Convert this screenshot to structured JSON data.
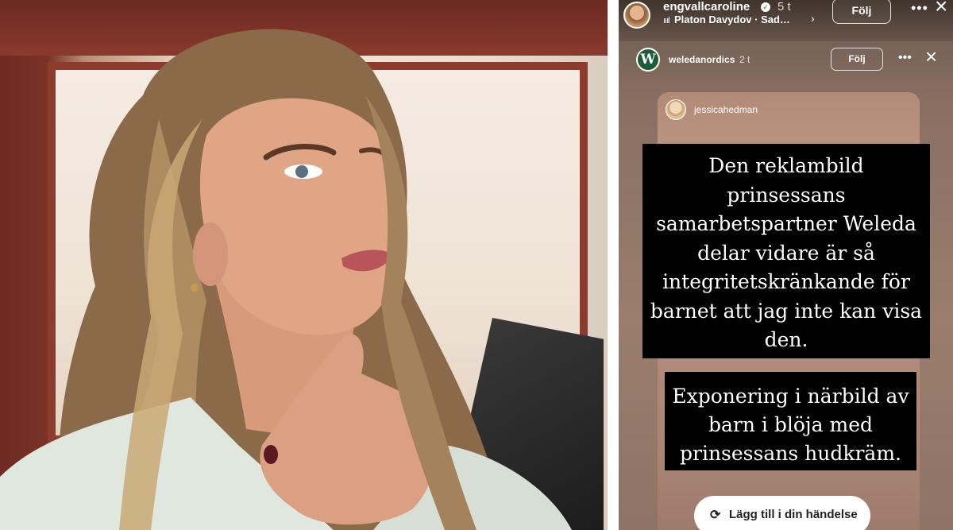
{
  "story": {
    "username": "engvallcaroline",
    "time": "5 t",
    "music": "Platon Davydov · Sad…",
    "follow_label": "Följ",
    "inner": {
      "avatar_letter": "W",
      "username": "weledanordics",
      "time": "2 t",
      "follow_label": "Följ"
    },
    "repost": {
      "username": "jessicahedman"
    },
    "caption_1": [
      "Den reklambild",
      "prinsessans",
      "samarbetspartner Weleda",
      "delar vidare är så",
      "integritetskränkande för",
      "barnet att jag inte kan visa",
      "den."
    ],
    "caption_2": [
      "Exponering i närbild av",
      "barn i blöja med",
      "prinsessans hudkräm."
    ],
    "add_label": "Lägg till i din händelse"
  },
  "icons": {
    "verified": "verified-badge-icon",
    "music": "audio-wave-icon",
    "more": "more-horizontal-icon",
    "close": "close-icon",
    "refresh": "repost-refresh-icon"
  },
  "colors": {
    "caption_bg": "#000000",
    "weleda_green": "#1f5a3a"
  }
}
